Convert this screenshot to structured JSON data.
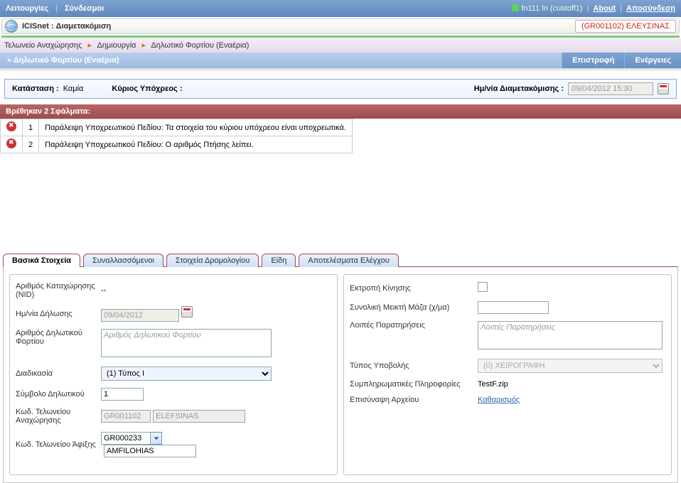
{
  "topbar": {
    "menu": [
      "Λειτουργίες",
      "Σύνδεσμοι"
    ],
    "user": "fn111 ln (custoff1)",
    "about": "About",
    "logout": "Αποσύνδεση"
  },
  "appline": {
    "title": "ICISnet : Διαμετακόμιση",
    "office": "(GR001102) ΕΛΕΥΣΙΝΑΣ"
  },
  "breadcrumb": [
    "Τελωνείο Αναχώρησης",
    "Δημιουργία",
    "Δηλωτικό Φορτίου (Εναέρια)"
  ],
  "pageband": {
    "title": "» Δηλωτικό Φορτίου (Εναέρια)",
    "btn_back": "Επιστροφή",
    "btn_actions": "Ενέργειες"
  },
  "status": {
    "status_label": "Κατάσταση :",
    "status_value": "Καμία",
    "main_oblig_label": "Κύριος Υπόχρεος :",
    "main_oblig_value": "",
    "transit_date_label": "Ημ/νία Διαμετακόμισης :",
    "transit_date_value": "09/04/2012 15:30"
  },
  "errors": {
    "header": "Βρέθηκαν 2 Σφάλματα:",
    "rows": [
      {
        "n": "1",
        "msg": "Παράλειψη Υποχρεωτικού Πεδίου: Τα στοιχεία του κύριου υπόχρεου είναι υποχρεωτικά."
      },
      {
        "n": "2",
        "msg": "Παράλειψη Υποχρεωτικού Πεδίου: Ο αριθμός Πτήσης λείπει."
      }
    ]
  },
  "tabs": [
    "Βασικά Στοιχεία",
    "Συναλλασσόμενοι",
    "Στοιχεία Δρομολογίου",
    "Είδη",
    "Αποτελέσματα Ελέγχου"
  ],
  "form": {
    "left": {
      "nid_label": "Αριθμός Καταχώρησης (NID)",
      "nid_value": "--",
      "decl_date_label": "Ημ/νία Δήλωσης",
      "decl_date_value": "09/04/2012",
      "decl_num_label": "Αριθμός Δηλωτικού Φορτίου",
      "decl_num_placeholder": "Αριθμός Δηλωτικού Φορτίου",
      "procedure_label": "Διαδικασία",
      "procedure_value": "(1) Τύπος Ι",
      "symbol_label": "Σύμβολο Δηλωτικού",
      "symbol_value": "1",
      "dep_code_label": "Κωδ. Τελωνείου Αναχώρησης",
      "dep_code_value": "GR001102",
      "dep_name_value": "ELEFSINAS",
      "arr_code_label": "Κωδ. Τελωνείου Άφιξης",
      "arr_code_value": "GR000233",
      "arr_name_value": "AMFILOHIAS"
    },
    "right": {
      "diversion_label": "Εκτροπή Κίνησης",
      "gross_mass_label": "Συνολική Μεικτή Μάζα (χ/μα)",
      "gross_mass_value": "",
      "notes_label": "Λοιπές Παρατηρήσεις",
      "notes_placeholder": "Λοιπές Παρατηρήσεις",
      "submit_type_label": "Τύπος Υποβολής",
      "submit_type_value": "(0) ΧΕΙΡΟΓΡΑΦΗ",
      "extra_info_label": "Συμπληρωματικές Πληροφορίες",
      "attach_label": "Επισύναψη Αρχείου",
      "attach_file": "TestF.zip",
      "clear_link": "Καθαρισμός"
    }
  }
}
